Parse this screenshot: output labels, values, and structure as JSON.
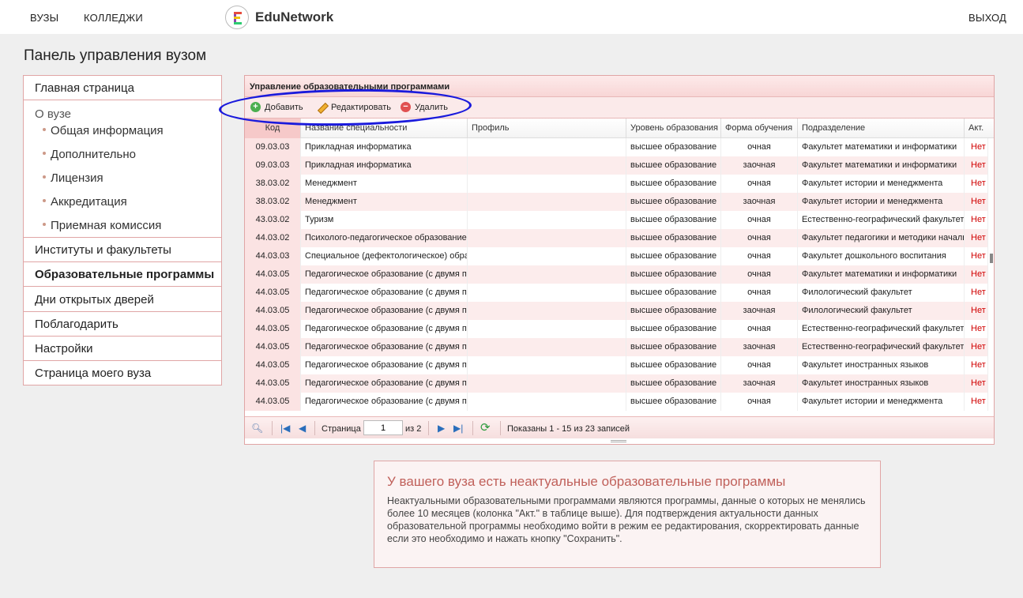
{
  "header": {
    "nav": [
      "ВУЗЫ",
      "КОЛЛЕДЖИ"
    ],
    "logo_text": "EduNetwork",
    "logout": "ВЫХОД"
  },
  "page_title": "Панель управления вузом",
  "sidebar": {
    "home": "Главная страница",
    "about_group": "О вузе",
    "about_items": [
      "Общая информация",
      "Дополнительно",
      "Лицензия",
      "Аккредитация",
      "Приемная комиссия"
    ],
    "items": [
      "Институты и факультеты",
      "Образовательные программы",
      "Дни открытых дверей",
      "Поблагодарить",
      "Настройки",
      "Страница моего вуза"
    ],
    "active_index": 1
  },
  "grid": {
    "caption": "Управление образовательными программами",
    "toolbar": {
      "add": "Добавить",
      "edit": "Редактировать",
      "delete": "Удалить"
    },
    "columns": [
      "Код",
      "Название специальности",
      "Профиль",
      "Уровень образования",
      "Форма обучения",
      "Подразделение",
      "Акт."
    ],
    "rows": [
      [
        "09.03.03",
        "Прикладная информатика",
        "",
        "высшее образование",
        "очная",
        "Факультет математики и информатики",
        "Нет"
      ],
      [
        "09.03.03",
        "Прикладная информатика",
        "",
        "высшее образование",
        "заочная",
        "Факультет математики и информатики",
        "Нет"
      ],
      [
        "38.03.02",
        "Менеджмент",
        "",
        "высшее образование",
        "очная",
        "Факультет истории и менеджмента",
        "Нет"
      ],
      [
        "38.03.02",
        "Менеджмент",
        "",
        "высшее образование",
        "заочная",
        "Факультет истории и менеджмента",
        "Нет"
      ],
      [
        "43.03.02",
        "Туризм",
        "",
        "высшее образование",
        "очная",
        "Естественно-географический факультет",
        "Нет"
      ],
      [
        "44.03.02",
        "Психолого-педагогическое образование",
        "",
        "высшее образование",
        "очная",
        "Факультет педагогики и методики начального образования",
        "Нет"
      ],
      [
        "44.03.03",
        "Специальное (дефектологическое) образование",
        "",
        "высшее образование",
        "очная",
        "Факультет дошкольного воспитания",
        "Нет"
      ],
      [
        "44.03.05",
        "Педагогическое образование (с двумя профилями подготовки)",
        "",
        "высшее образование",
        "очная",
        "Факультет математики и информатики",
        "Нет"
      ],
      [
        "44.03.05",
        "Педагогическое образование (с двумя профилями подготовки)",
        "",
        "высшее образование",
        "очная",
        "Филологический факультет",
        "Нет"
      ],
      [
        "44.03.05",
        "Педагогическое образование (с двумя профилями подготовки)",
        "",
        "высшее образование",
        "заочная",
        "Филологический факультет",
        "Нет"
      ],
      [
        "44.03.05",
        "Педагогическое образование (с двумя профилями подготовки)",
        "",
        "высшее образование",
        "очная",
        "Естественно-географический факультет",
        "Нет"
      ],
      [
        "44.03.05",
        "Педагогическое образование (с двумя профилями подготовки)",
        "",
        "высшее образование",
        "заочная",
        "Естественно-географический факультет",
        "Нет"
      ],
      [
        "44.03.05",
        "Педагогическое образование (с двумя профилями подготовки)",
        "",
        "высшее образование",
        "очная",
        "Факультет иностранных языков",
        "Нет"
      ],
      [
        "44.03.05",
        "Педагогическое образование (с двумя профилями подготовки)",
        "",
        "высшее образование",
        "заочная",
        "Факультет иностранных языков",
        "Нет"
      ],
      [
        "44.03.05",
        "Педагогическое образование (с двумя профилями подготовки)",
        "",
        "высшее образование",
        "очная",
        "Факультет истории и менеджмента",
        "Нет"
      ]
    ],
    "pager": {
      "page_label": "Страница",
      "page_value": "1",
      "of_label": "из 2",
      "records": "Показаны 1 - 15 из 23 записей"
    }
  },
  "notice": {
    "title": "У вашего вуза есть неактуальные образовательные программы",
    "text": "Неактуальными образовательными программами являются программы, данные о которых не менялись более 10 месяцев (колонка \"Акт.\" в таблице выше). Для подтверждения актуальности данных образовательной программы необходимо войти в режим ее редактирования, скорректировать данные если это необходимо и нажать кнопку \"Сохранить\"."
  },
  "colors": {
    "accent_border": "#e0a5a5",
    "inactive_red": "#d00000",
    "annotation_blue": "#1a1adc"
  }
}
